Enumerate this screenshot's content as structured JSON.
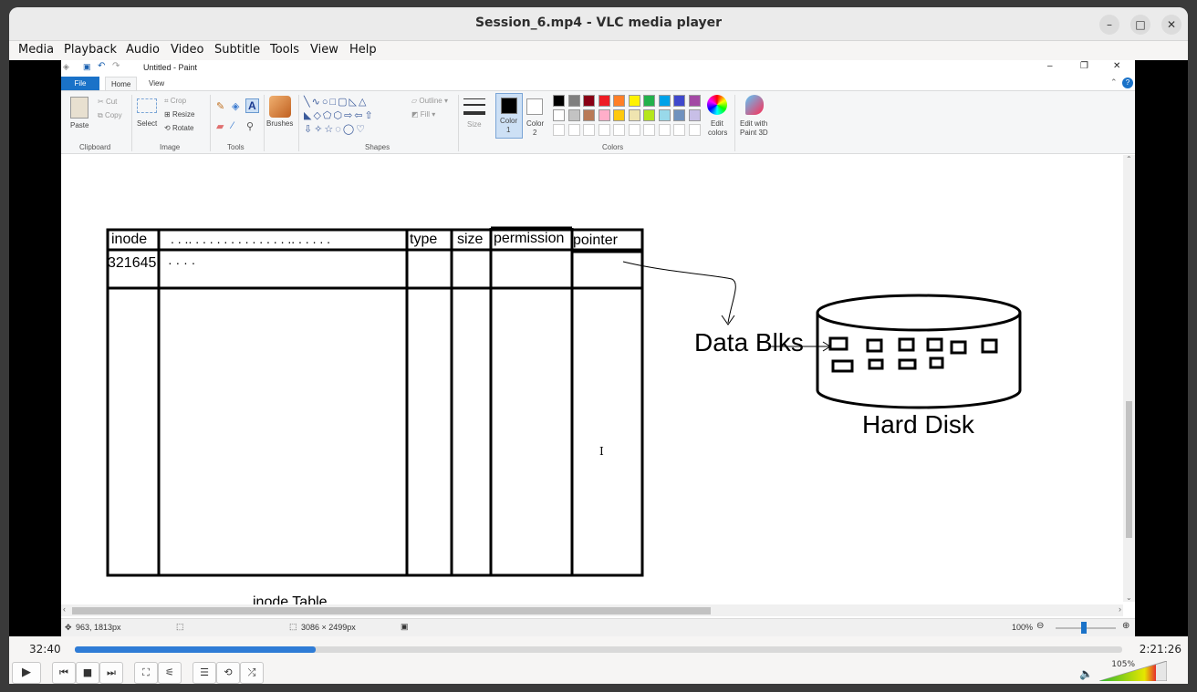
{
  "window": {
    "title": "Session_6.mp4 - VLC media player",
    "minimize": "–",
    "maximize": "□",
    "close": "✕"
  },
  "menu": [
    "Media",
    "Playback",
    "Audio",
    "Video",
    "Subtitle",
    "Tools",
    "View",
    "Help"
  ],
  "paint": {
    "title": "Untitled - Paint",
    "tabs": {
      "file": "File",
      "home": "Home",
      "view": "View"
    },
    "clipboard": {
      "paste": "Paste",
      "cut": "Cut",
      "copy": "Copy",
      "label": "Clipboard"
    },
    "image": {
      "select": "Select",
      "crop": "Crop",
      "resize": "Resize",
      "rotate": "Rotate",
      "label": "Image"
    },
    "tools": {
      "label": "Tools"
    },
    "brushes": "Brushes",
    "shapes": {
      "outline": "Outline",
      "fill": "Fill",
      "label": "Shapes"
    },
    "size": "Size",
    "color1": "Color",
    "color1_num": "1",
    "color2": "Color",
    "color2_num": "2",
    "colors_label": "Colors",
    "edit_colors": "Edit",
    "edit_colors_2": "colors",
    "edit_paint3d": "Edit with",
    "edit_paint3d_2": "Paint 3D",
    "palette": [
      "#000000",
      "#7f7f7f",
      "#880015",
      "#ed1c24",
      "#ff7f27",
      "#fff200",
      "#22b14c",
      "#00a2e8",
      "#3f48cc",
      "#a349a4",
      "#ffffff",
      "#c3c3c3",
      "#b97a57",
      "#ffaec9",
      "#ffc90e",
      "#efe4b0",
      "#b5e61d",
      "#99d9ea",
      "#7092be",
      "#c8bfe7"
    ],
    "status": {
      "cursor": "963, 1813px",
      "dimensions": "3086 × 2499px",
      "zoom": "100%"
    }
  },
  "canvas": {
    "headers": {
      "inode": "inode",
      "dots": ". . .. . . . . . . . . . . . . . .. . . . . .",
      "type": "type",
      "size": "size",
      "permission": "permission",
      "pointer": "pointer"
    },
    "row1": {
      "inode": "321645",
      "dots": "· · · ·"
    },
    "table_caption": "inode Table",
    "data_blks": "Data Blks",
    "hard_disk": "Hard Disk",
    "cursor_glyph": "I"
  },
  "player": {
    "time_current": "32:40",
    "time_total": "2:21:26",
    "progress": 0.23,
    "volume": "105%"
  }
}
